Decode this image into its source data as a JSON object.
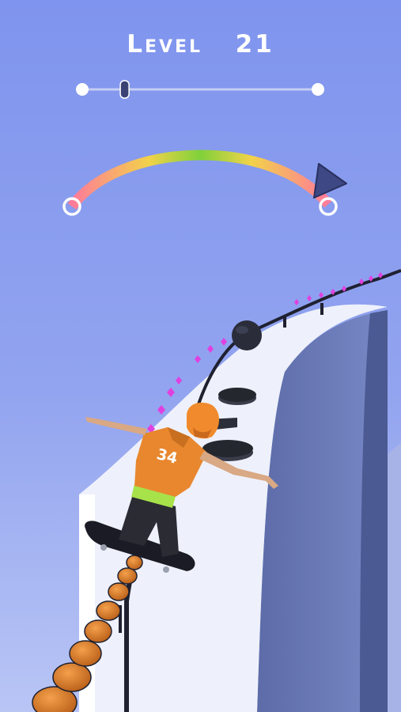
{
  "hud": {
    "level_label": "Level",
    "level_number": "21",
    "progress": 0.18,
    "balance_meter": {
      "gradient_colors": [
        "#ff7a9a",
        "#f2d24a",
        "#7fd13a",
        "#f2d24a",
        "#ff7a9a"
      ],
      "indicator": "triangle-marker-right"
    }
  },
  "player": {
    "jersey_number": "34",
    "jersey_color": "#e8872e",
    "helmet_color": "#f08a2c"
  },
  "colors": {
    "sky_top": "#7f94ee",
    "sky_bottom": "#b9c5f5",
    "track": "#eef1fb",
    "gem": "#e040e0",
    "pole": "#d9782a"
  }
}
